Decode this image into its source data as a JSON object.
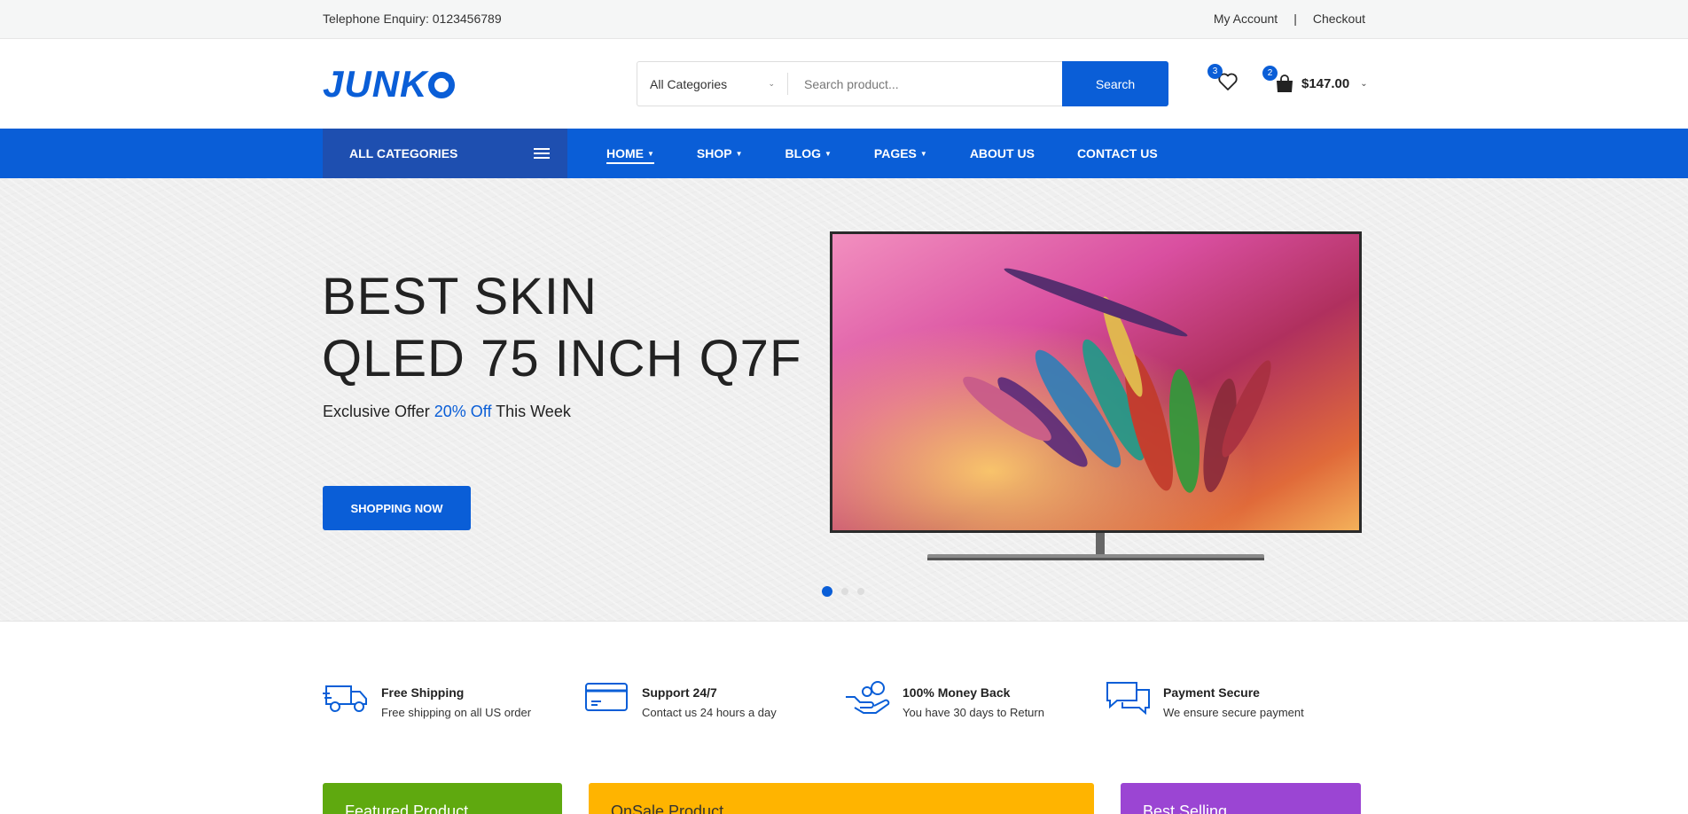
{
  "topbar": {
    "phone": "Telephone Enquiry: 0123456789",
    "my_account": "My Account",
    "separator": "|",
    "checkout": "Checkout"
  },
  "header": {
    "logo": "JUNK",
    "search": {
      "category": "All Categories",
      "placeholder": "Search product...",
      "button": "Search"
    },
    "wishlist_count": "3",
    "cart_count": "2",
    "cart_total": "$147.00"
  },
  "nav": {
    "all_categories": "ALL CATEGORIES",
    "items": [
      {
        "label": "HOME",
        "active": true,
        "dropdown": true
      },
      {
        "label": "SHOP",
        "dropdown": true
      },
      {
        "label": "BLOG",
        "dropdown": true
      },
      {
        "label": "PAGES",
        "dropdown": true
      },
      {
        "label": "ABOUT US",
        "dropdown": false
      },
      {
        "label": "CONTACT US",
        "dropdown": false
      }
    ]
  },
  "hero": {
    "line1": "BEST SKIN",
    "line2": "QLED 75 INCH Q7F",
    "offer_prefix": "Exclusive Offer",
    "offer_highlight": "20% Off",
    "offer_suffix": "This Week",
    "button": "SHOPPING NOW",
    "slide_count": 3,
    "active_slide": 1
  },
  "features": [
    {
      "icon": "truck-icon",
      "title": "Free Shipping",
      "desc": "Free shipping on all US order"
    },
    {
      "icon": "card-icon",
      "title": "Support 24/7",
      "desc": "Contact us 24 hours a day"
    },
    {
      "icon": "money-back-icon",
      "title": "100% Money Back",
      "desc": "You have 30 days to Return"
    },
    {
      "icon": "chat-icon",
      "title": "Payment Secure",
      "desc": "We ensure secure payment"
    }
  ],
  "boxes": {
    "featured": "Featured Product",
    "onsale": "OnSale Product",
    "bestselling": "Best Selling"
  },
  "colors": {
    "accent": "#0a5ed7",
    "nav_dark": "#1e4fb0",
    "green": "#5fa90f",
    "yellow": "#ffb400",
    "purple": "#9b45d3"
  }
}
